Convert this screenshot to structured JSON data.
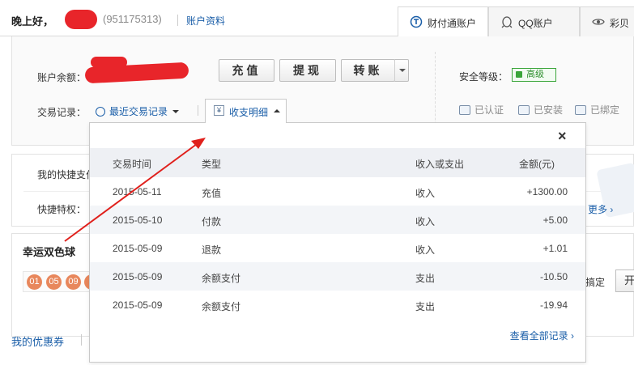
{
  "header": {
    "greeting": "晚上好，",
    "qq_number": "(951175313)",
    "account_info_link": "账户资料"
  },
  "tabs": [
    {
      "label": "财付通账户",
      "icon": "tenpay-icon",
      "active": true
    },
    {
      "label": "QQ账户",
      "icon": "qq-penguin-icon",
      "active": false
    },
    {
      "label": "彩贝",
      "icon": "eye-icon",
      "active": false
    }
  ],
  "account": {
    "balance_label": "账户余额：",
    "buttons": {
      "recharge": "充值",
      "withdraw": "提现",
      "transfer": "转账"
    },
    "security_label": "安全等级：",
    "security_level": "高级",
    "statuses": [
      "已认证",
      "已安装",
      "已绑定"
    ],
    "transactions_label": "交易记录：",
    "recent_tx": "最近交易记录",
    "income_detail_tab": "收支明细"
  },
  "background": {
    "quickpay": "我的快捷支付",
    "quickperm": "快捷特权：",
    "more": "更多",
    "lottery_title": "幸运双色球",
    "balls": [
      "01",
      "05",
      "09"
    ],
    "side_text": "搞定",
    "side_button": "开",
    "coupon": "我的优惠券"
  },
  "popup": {
    "close": "×",
    "columns": [
      "交易时间",
      "类型",
      "收入或支出",
      "金额(元)"
    ],
    "rows": [
      {
        "date": "2015-05-11",
        "type": "充值",
        "io": "收入",
        "amount": "+1300.00"
      },
      {
        "date": "2015-05-10",
        "type": "付款",
        "io": "收入",
        "amount": "+5.00"
      },
      {
        "date": "2015-05-09",
        "type": "退款",
        "io": "收入",
        "amount": "+1.01"
      },
      {
        "date": "2015-05-09",
        "type": "余额支付",
        "io": "支出",
        "amount": "-10.50"
      },
      {
        "date": "2015-05-09",
        "type": "余额支付",
        "io": "支出",
        "amount": "-19.94"
      }
    ],
    "view_all": "查看全部记录 ›"
  },
  "colors": {
    "link": "#1a5ea8",
    "redaction": "#e8252a",
    "security_green": "#3aa53a",
    "annotation_arrow": "#e0201c"
  }
}
